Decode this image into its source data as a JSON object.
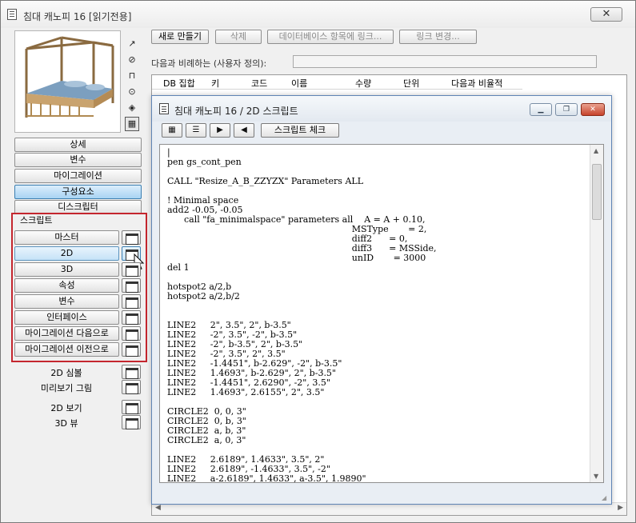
{
  "window": {
    "title": "침대 캐노피 16 [읽기전용]",
    "close_icon": "close-icon"
  },
  "side_tools": [
    "↗",
    "⊘",
    "⊓",
    "⊙",
    "◈",
    "▦"
  ],
  "nav_buttons": [
    "상세",
    "변수",
    "마이그레이션",
    "구성요소",
    "디스크립터"
  ],
  "scripts": {
    "label": "스크립트",
    "items": [
      "마스터",
      "2D",
      "3D",
      "속성",
      "변수",
      "인터페이스",
      "마이그레이션 다음으로",
      "마이그레이션 이전으로"
    ]
  },
  "extra_items": [
    "2D 심볼",
    "미리보기 그림",
    "2D 보기",
    "3D 뷰"
  ],
  "toolbar": {
    "new": "새로 만들기",
    "delete": "삭제",
    "link": "데이터베이스 항목에 링크...",
    "change_link": "링크 변경..."
  },
  "ratio_label": "다음과 비례하는 (사용자 정의):",
  "list_columns": [
    "DB 집합",
    "키",
    "코드",
    "이름",
    "수량",
    "단위",
    "다음과 비율적"
  ],
  "editor": {
    "title": "침대 캐노피 16 / 2D 스크립트",
    "check_button": "스크립트 체크",
    "tool_icons": [
      "list-icon",
      "indent-icon",
      "play-indent-icon",
      "outdent-icon"
    ],
    "minimize": "▁",
    "restore": "❐",
    "close": "✕",
    "code": "|\npen gs_cont_pen\n\nCALL \"Resize_A_B_ZZYZX\" Parameters ALL\n\n! Minimal space\nadd2 -0.05, -0.05\n      call \"fa_minimalspace\" parameters all    A = A + 0.10,\n                                                                  MSType       = 2,\n                                                                  diff2      = 0,\n                                                                  diff3      = MSSide,\n                                                                  unID       = 3000\ndel 1\n\nhotspot2 a/2,b\nhotspot2 a/2,b/2\n\n\nLINE2     2\", 3.5\", 2\", b-3.5\"\nLINE2     -2\", 3.5\", -2\", b-3.5\"\nLINE2     -2\", b-3.5\", 2\", b-3.5\"\nLINE2     -2\", 3.5\", 2\", 3.5\"\nLINE2     -1.4451\", b-2.629\", -2\", b-3.5\"\nLINE2     1.4693\", b-2.629\", 2\", b-3.5\"\nLINE2     -1.4451\", 2.6290\", -2\", 3.5\"\nLINE2     1.4693\", 2.6155\", 2\", 3.5\"\n\nCIRCLE2  0, 0, 3\"\nCIRCLE2  0, b, 3\"\nCIRCLE2  a, b, 3\"\nCIRCLE2  a, 0, 3\"\n\nLINE2     2.6189\", 1.4633\", 3.5\", 2\"\nLINE2     2.6189\", -1.4633\", 3.5\", -2\"\nLINE2     a-2.6189\", 1.4633\", a-3.5\", 1.9890\""
  }
}
